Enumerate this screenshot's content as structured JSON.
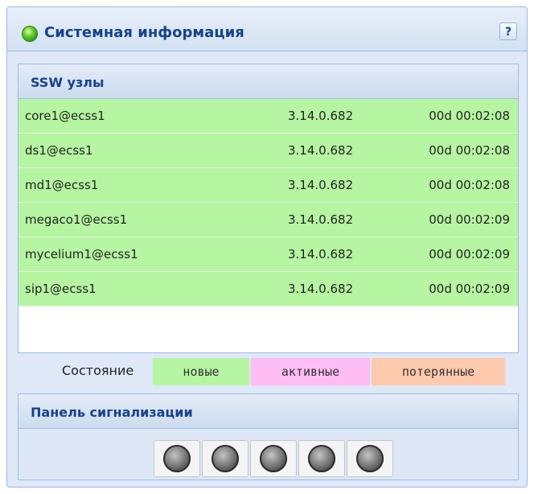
{
  "window": {
    "title": "Системная информация",
    "help_label": "?"
  },
  "nodes_panel": {
    "header": "SSW узлы",
    "rows": [
      {
        "name": "core1@ecss1",
        "version": "3.14.0.682",
        "uptime": "00d 00:02:08",
        "state": "новые"
      },
      {
        "name": "ds1@ecss1",
        "version": "3.14.0.682",
        "uptime": "00d 00:02:08",
        "state": "новые"
      },
      {
        "name": "md1@ecss1",
        "version": "3.14.0.682",
        "uptime": "00d 00:02:08",
        "state": "новые"
      },
      {
        "name": "megaco1@ecss1",
        "version": "3.14.0.682",
        "uptime": "00d 00:02:09",
        "state": "новые"
      },
      {
        "name": "mycelium1@ecss1",
        "version": "3.14.0.682",
        "uptime": "00d 00:02:09",
        "state": "новые"
      },
      {
        "name": "sip1@ecss1",
        "version": "3.14.0.682",
        "uptime": "00d 00:02:09",
        "state": "новые"
      }
    ]
  },
  "legend": {
    "label": "Состояние",
    "new": "новые",
    "active": "активные",
    "lost": "потерянные"
  },
  "alarm_panel": {
    "header": "Панель сигнализации",
    "indicators": [
      "off",
      "off",
      "off",
      "off",
      "off"
    ]
  },
  "colors": {
    "new": "#b6f5a2",
    "active": "#ffbdf4",
    "lost": "#ffc9ae",
    "title_text": "#15428b",
    "status_led": "#4cbf1f"
  },
  "icons": {
    "status": "green-status-led-icon",
    "help": "question-mark-icon",
    "alarm": "alarm-led-icon"
  }
}
